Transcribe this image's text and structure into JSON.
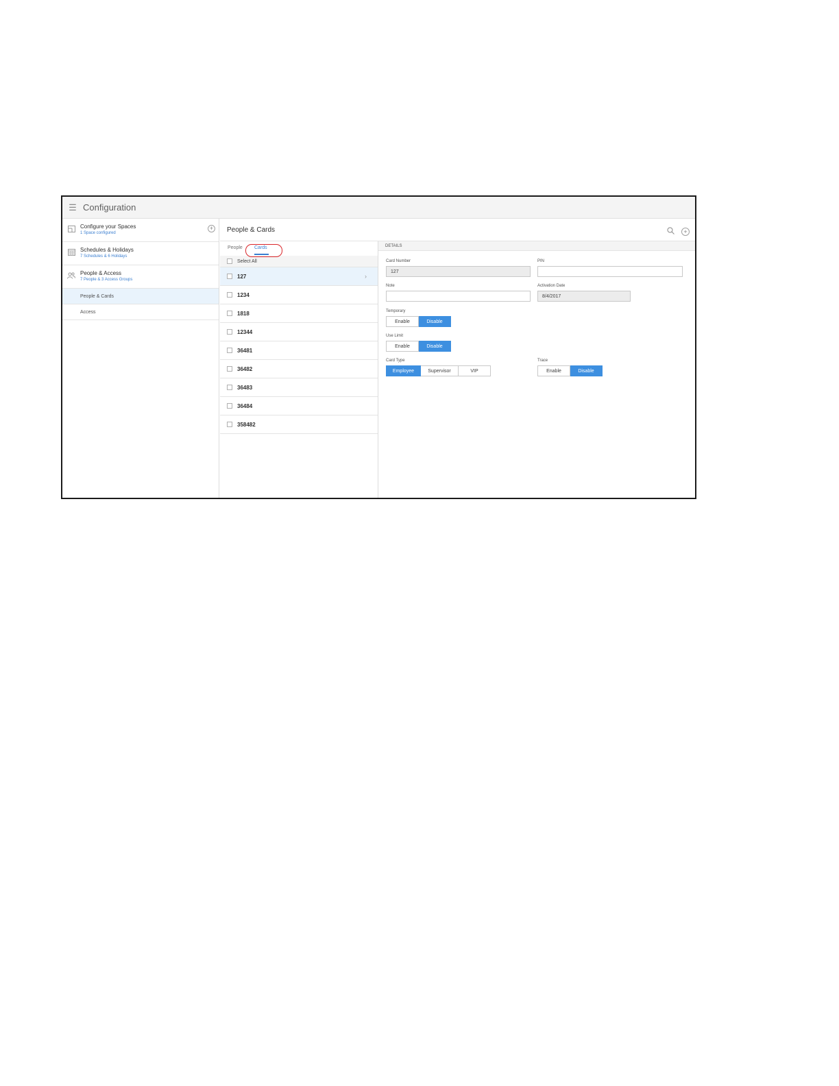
{
  "topbar": {
    "title": "Configuration"
  },
  "sidebar": {
    "sections": [
      {
        "title": "Configure your Spaces",
        "subtitle": "1 Space configured"
      },
      {
        "title": "Schedules & Holidays",
        "subtitle": "7 Schedules & 6 Holidays"
      },
      {
        "title": "People & Access",
        "subtitle": "7 People & 3 Access Groups"
      }
    ],
    "subitems": [
      {
        "label": "People & Cards"
      },
      {
        "label": "Access"
      }
    ]
  },
  "main": {
    "title": "People & Cards"
  },
  "list": {
    "tabs": {
      "people": "People",
      "cards": "Cards"
    },
    "select_all": "Select All",
    "cards": [
      "127",
      "1234",
      "1818",
      "12344",
      "36481",
      "36482",
      "36483",
      "36484",
      "358482"
    ]
  },
  "details": {
    "header": "DETAILS",
    "card_number": {
      "label": "Card Number",
      "value": "127"
    },
    "pin": {
      "label": "PIN",
      "value": ""
    },
    "note": {
      "label": "Note",
      "value": ""
    },
    "activation_date": {
      "label": "Activation Date",
      "value": "8/4/2017"
    },
    "temporary": {
      "label": "Temporary",
      "enable": "Enable",
      "disable": "Disable",
      "selected": "Disable"
    },
    "use_limit": {
      "label": "Use Limit",
      "enable": "Enable",
      "disable": "Disable",
      "selected": "Disable"
    },
    "card_type": {
      "label": "Card Type",
      "employee": "Employee",
      "supervisor": "Supervisor",
      "vip": "VIP",
      "selected": "Employee"
    },
    "trace": {
      "label": "Trace",
      "enable": "Enable",
      "disable": "Disable",
      "selected": "Disable"
    }
  },
  "colors": {
    "accent": "#3d8fe0",
    "link": "#3a7ed0",
    "highlight_ring": "#d9262a",
    "selected_row": "#e9f3fc"
  }
}
